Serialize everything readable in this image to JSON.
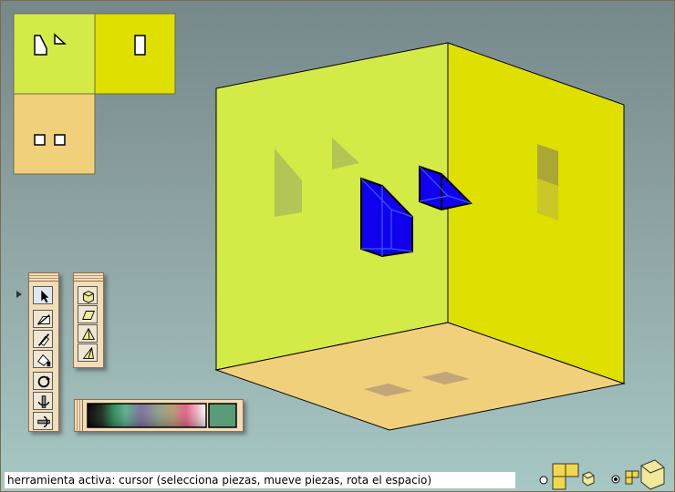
{
  "status": {
    "text": "herramienta activa: cursor (selecciona piezas, mueve piezas, rota el espacio)"
  },
  "colors": {
    "left_wall": "#d4ea46",
    "right_wall": "#dfdf00",
    "floor": "#f0d07a",
    "piece": "#1000ee",
    "background_top": "#76888a",
    "background_bottom": "#a6c8c4",
    "toolbar": "#f3ddb8",
    "selected_color": "#5a9b78"
  },
  "projection_views": [
    {
      "name": "left-view",
      "shapes": [
        "trapezoid",
        "triangle"
      ]
    },
    {
      "name": "front-view",
      "shapes": [
        "rectangle"
      ]
    },
    {
      "name": "top-view",
      "shapes": [
        "square",
        "square"
      ]
    }
  ],
  "tools": [
    {
      "name": "cursor-tool",
      "icon": "arrow-cursor-icon",
      "selected": true
    },
    {
      "name": "move-piece-tool",
      "icon": "move-piece-icon",
      "selected": false
    },
    {
      "name": "cut-tool",
      "icon": "cut-icon",
      "selected": false
    },
    {
      "name": "paint-tool",
      "icon": "paint-icon",
      "selected": false
    },
    {
      "name": "rotate-tool",
      "icon": "rotate-icon",
      "selected": false
    },
    {
      "name": "rotate-x-tool",
      "icon": "rotate-x-icon",
      "selected": false
    },
    {
      "name": "rotate-y-tool",
      "icon": "rotate-y-icon",
      "selected": false
    }
  ],
  "solids": [
    {
      "name": "cube-solid",
      "icon": "cube-icon"
    },
    {
      "name": "prism-solid",
      "icon": "prism-icon"
    },
    {
      "name": "pyramid-solid",
      "icon": "pyramid-icon"
    },
    {
      "name": "wedge-solid",
      "icon": "wedge-icon"
    }
  ],
  "view_modes": [
    {
      "name": "view-mode-projections",
      "selected": false
    },
    {
      "name": "view-mode-perspective",
      "selected": true
    }
  ]
}
